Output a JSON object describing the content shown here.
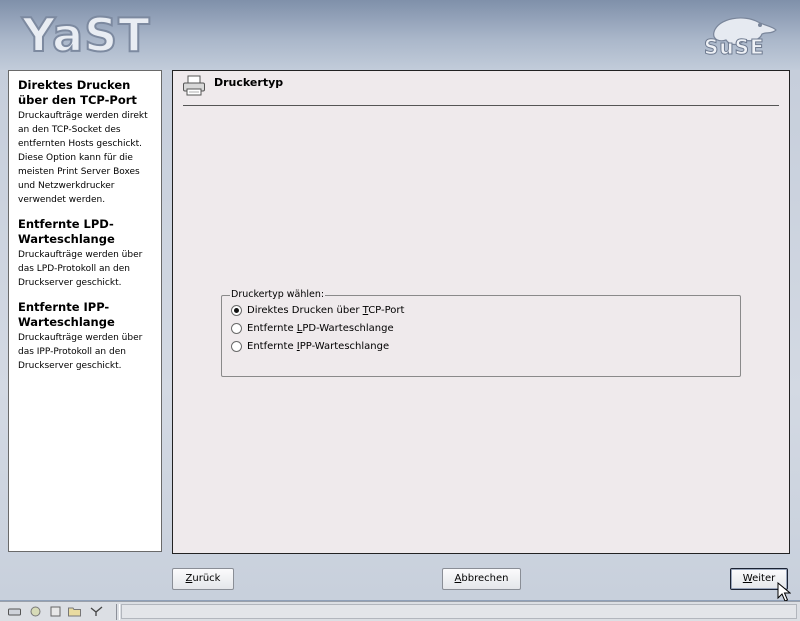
{
  "header": {
    "logo_text": "YaST",
    "brand_text": "SuSE"
  },
  "help": {
    "sections": [
      {
        "title": "Direktes Drucken über den TCP-Port",
        "text": "Druckaufträge werden direkt an den TCP-Socket des entfernten Hosts geschickt. Diese Option kann für die meisten Print Server Boxes und Netzwerkdrucker verwendet werden."
      },
      {
        "title": "Entfernte LPD-Warteschlange",
        "text": "Druckaufträge werden über das LPD-Protokoll an den Druckserver geschickt."
      },
      {
        "title": "Entfernte IPP-Warteschlange",
        "text": "Druckaufträge werden über das IPP-Protokoll an den Druckserver geschickt."
      }
    ]
  },
  "content": {
    "title": "Druckertyp",
    "icon": "printer-icon",
    "group_label": "Druckertyp wählen:",
    "options": [
      {
        "pre": "Direktes Drucken über ",
        "key": "T",
        "post": "CP-Port",
        "checked": true
      },
      {
        "pre": "Entfernte ",
        "key": "L",
        "post": "PD-Warteschlange",
        "checked": false
      },
      {
        "pre": "Entfernte ",
        "key": "I",
        "post": "PP-Warteschlange",
        "checked": false
      }
    ]
  },
  "buttons": {
    "back": {
      "key": "Z",
      "rest": "urück"
    },
    "abort": {
      "key": "A",
      "rest": "bbrechen"
    },
    "next": {
      "key": "W",
      "rest": "eiter"
    }
  },
  "taskbar": {
    "icons": [
      "drive-icon",
      "kde-menu-icon",
      "home-icon",
      "folder-icon",
      "network-icon"
    ]
  },
  "colors": {
    "content_bg": "#efeaec",
    "header_bg": "#a9b6c9"
  }
}
